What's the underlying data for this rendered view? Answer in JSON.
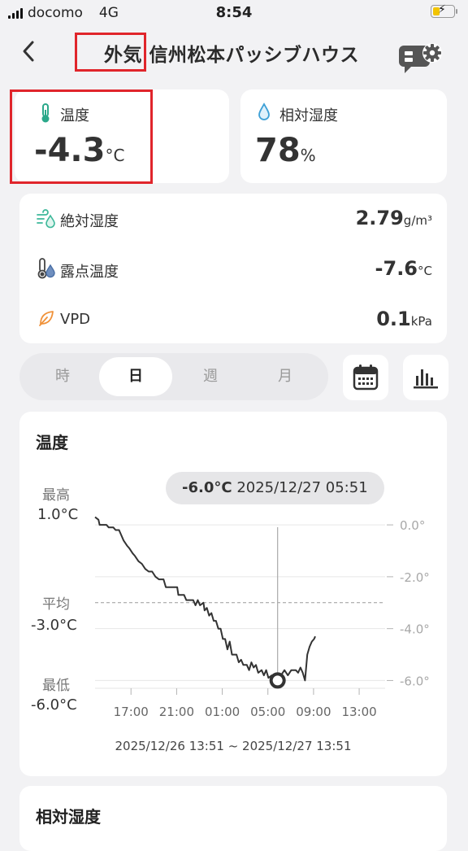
{
  "status_bar": {
    "carrier": "docomo",
    "network": "4G",
    "time": "8:54",
    "battery_level": 0.35,
    "battery_color": "#f2c400"
  },
  "header": {
    "title_prefix": "外気",
    "title_main": "信州松本パッシブハウス",
    "back_icon": "chevron-left-icon",
    "settings_icon": "device-settings-gear-icon"
  },
  "temperature": {
    "label": "温度",
    "value": "-4.3",
    "unit": "°C",
    "icon": "thermometer-icon"
  },
  "humidity": {
    "label": "相対湿度",
    "value": "78",
    "unit": "%",
    "icon": "water-drop-icon"
  },
  "metrics": [
    {
      "label": "絶対湿度",
      "value": "2.79",
      "unit": "g/m³",
      "icon": "wind-drop-icon",
      "icon_color": "#3db89a"
    },
    {
      "label": "露点温度",
      "value": "-7.6",
      "unit": "°C",
      "icon": "dewpoint-thermometer-icon",
      "icon_color": "#4a6fa5"
    },
    {
      "label": "VPD",
      "value": "0.1",
      "unit": "kPa",
      "icon": "leaf-icon",
      "icon_color": "#f0923a"
    }
  ],
  "period_tabs": [
    {
      "label": "時",
      "active": false
    },
    {
      "label": "日",
      "active": true
    },
    {
      "label": "週",
      "active": false
    },
    {
      "label": "月",
      "active": false
    }
  ],
  "toolbar": {
    "calendar_icon": "calendar-icon",
    "chart_icon": "bar-chart-icon"
  },
  "chart_card": {
    "title": "温度",
    "tooltip_value": "-6.0°C",
    "tooltip_time": "2025/12/27 05:51",
    "max_label": "最高",
    "max_value": "1.0°C",
    "avg_label": "平均",
    "avg_value": "-3.0°C",
    "min_label": "最低",
    "min_value": "-6.0°C",
    "date_range": "2025/12/26 13:51 ~ 2025/12/27 13:51"
  },
  "chart_data": {
    "type": "line",
    "title": "温度",
    "x_unit": "hours since 2025/12/26 13:51",
    "xlim": [
      0,
      24
    ],
    "x_ticks": [
      {
        "x": 3.15,
        "label": "17:00"
      },
      {
        "x": 7.15,
        "label": "21:00"
      },
      {
        "x": 11.15,
        "label": "01:00"
      },
      {
        "x": 15.15,
        "label": "05:00"
      },
      {
        "x": 19.15,
        "label": "09:00"
      },
      {
        "x": 23.15,
        "label": "13:00"
      }
    ],
    "ylim": [
      -6.3,
      0.6
    ],
    "y_ticks": [
      {
        "y": 0.0,
        "label": "0.0°"
      },
      {
        "y": -2.0,
        "label": "-2.0°"
      },
      {
        "y": -4.0,
        "label": "-4.0°"
      },
      {
        "y": -6.0,
        "label": "-6.0°"
      }
    ],
    "average": -3.0,
    "cursor": {
      "x": 16.0,
      "y": -6.0
    },
    "series": [
      {
        "values": [
          [
            0.0,
            0.3
          ],
          [
            0.3,
            0.2
          ],
          [
            0.4,
            0.0
          ],
          [
            1.0,
            0.0
          ],
          [
            1.2,
            -0.1
          ],
          [
            1.6,
            -0.1
          ],
          [
            1.8,
            -0.2
          ],
          [
            2.1,
            -0.2
          ],
          [
            2.3,
            -0.4
          ],
          [
            2.5,
            -0.6
          ],
          [
            2.8,
            -0.8
          ],
          [
            3.0,
            -0.9
          ],
          [
            3.3,
            -1.1
          ],
          [
            3.5,
            -1.2
          ],
          [
            3.8,
            -1.4
          ],
          [
            4.1,
            -1.5
          ],
          [
            4.4,
            -1.7
          ],
          [
            4.7,
            -1.8
          ],
          [
            5.0,
            -1.8
          ],
          [
            5.3,
            -2.0
          ],
          [
            5.6,
            -2.1
          ],
          [
            6.0,
            -2.1
          ],
          [
            6.2,
            -2.4
          ],
          [
            7.2,
            -2.4
          ],
          [
            7.3,
            -2.7
          ],
          [
            7.8,
            -2.7
          ],
          [
            8.0,
            -2.9
          ],
          [
            8.6,
            -2.9
          ],
          [
            8.8,
            -3.1
          ],
          [
            9.0,
            -2.9
          ],
          [
            9.2,
            -3.1
          ],
          [
            9.5,
            -3.0
          ],
          [
            9.6,
            -3.3
          ],
          [
            9.8,
            -3.2
          ],
          [
            10.0,
            -3.5
          ],
          [
            10.2,
            -3.4
          ],
          [
            10.4,
            -3.7
          ],
          [
            10.6,
            -3.7
          ],
          [
            10.8,
            -4.0
          ],
          [
            11.0,
            -4.0
          ],
          [
            11.2,
            -4.4
          ],
          [
            11.4,
            -4.4
          ],
          [
            11.6,
            -4.8
          ],
          [
            11.8,
            -4.5
          ],
          [
            12.0,
            -5.0
          ],
          [
            12.4,
            -5.0
          ],
          [
            12.6,
            -5.3
          ],
          [
            12.8,
            -5.2
          ],
          [
            13.0,
            -5.4
          ],
          [
            13.3,
            -5.4
          ],
          [
            13.5,
            -5.6
          ],
          [
            13.7,
            -5.3
          ],
          [
            13.9,
            -5.5
          ],
          [
            14.1,
            -5.4
          ],
          [
            14.3,
            -5.7
          ],
          [
            14.6,
            -5.6
          ],
          [
            14.8,
            -5.8
          ],
          [
            15.0,
            -5.6
          ],
          [
            15.2,
            -5.9
          ],
          [
            15.5,
            -5.8
          ],
          [
            15.8,
            -6.0
          ],
          [
            16.0,
            -6.0
          ],
          [
            16.3,
            -5.8
          ],
          [
            16.6,
            -5.6
          ],
          [
            16.9,
            -5.8
          ],
          [
            17.2,
            -5.6
          ],
          [
            17.6,
            -5.6
          ],
          [
            17.8,
            -5.7
          ],
          [
            18.0,
            -5.5
          ],
          [
            18.2,
            -5.7
          ],
          [
            18.4,
            -6.0
          ],
          [
            18.6,
            -5.0
          ],
          [
            18.8,
            -4.7
          ],
          [
            19.0,
            -4.5
          ],
          [
            19.2,
            -4.4
          ],
          [
            19.3,
            -4.3
          ]
        ]
      }
    ],
    "colors": {
      "line": "#333333",
      "cursor": "#aaaaaa",
      "grid": "#e6e6e6",
      "tick": "#b3b3b3"
    }
  },
  "second_chart": {
    "title": "相対湿度"
  }
}
